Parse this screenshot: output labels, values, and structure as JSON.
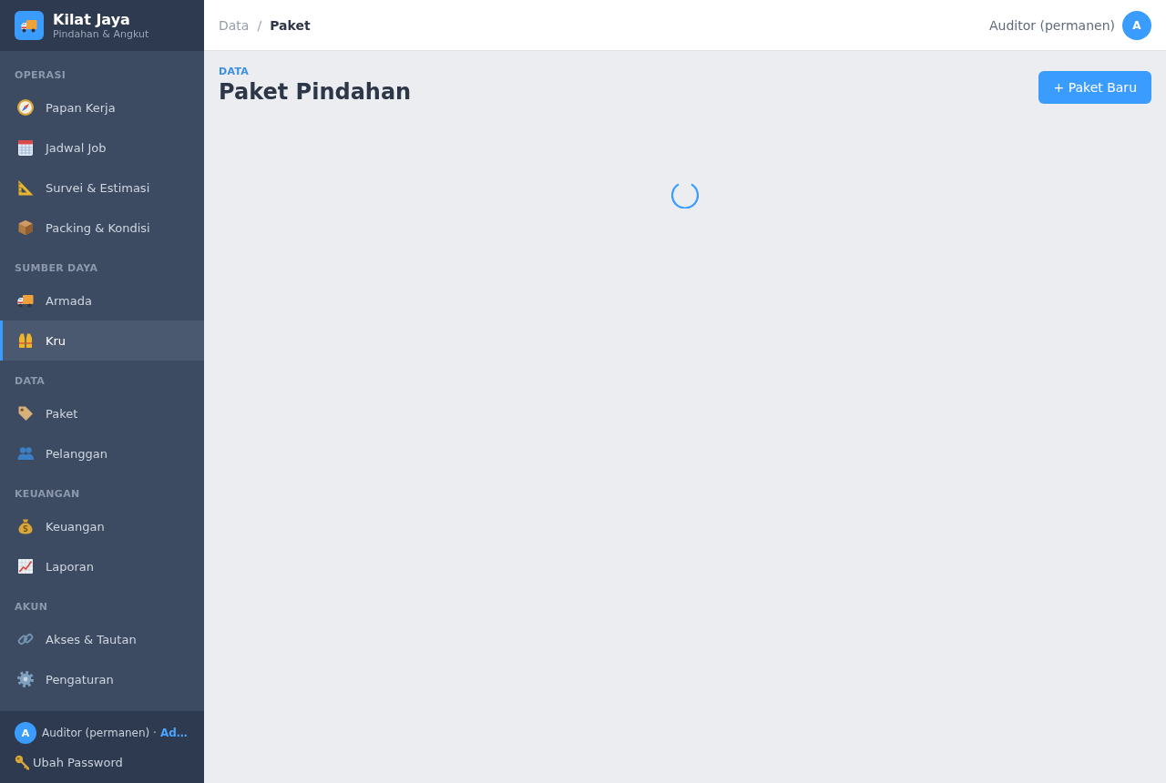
{
  "sidebar": {
    "brand": {
      "name": "Kilat Jaya",
      "tagline": "Pindahan & Angkut"
    },
    "sections": [
      {
        "title": "OPERASI",
        "items": [
          {
            "label": "Papan Kerja",
            "selected": false
          },
          {
            "label": "Jadwal Job",
            "selected": false
          },
          {
            "label": "Survei & Estimasi",
            "selected": false
          },
          {
            "label": "Packing & Kondisi",
            "selected": false
          }
        ]
      },
      {
        "title": "SUMBER DAYA",
        "items": [
          {
            "label": "Armada",
            "selected": false
          },
          {
            "label": "Kru",
            "selected": true
          }
        ]
      },
      {
        "title": "DATA",
        "items": [
          {
            "label": "Paket",
            "selected": false
          },
          {
            "label": "Pelanggan",
            "selected": false
          }
        ]
      },
      {
        "title": "KEUANGAN",
        "items": [
          {
            "label": "Keuangan",
            "selected": false
          },
          {
            "label": "Laporan",
            "selected": false
          }
        ]
      },
      {
        "title": "AKUN",
        "items": [
          {
            "label": "Akses & Tautan",
            "selected": false
          },
          {
            "label": "Pengaturan",
            "selected": false
          }
        ]
      }
    ],
    "footer": {
      "user": {
        "avatar": "A",
        "name": "Auditor (permanen) ·",
        "role": "Ad…"
      },
      "link": "Ubah Password"
    }
  },
  "topbar": {
    "breadcrumb": {
      "items": [
        "Data",
        "Paket"
      ],
      "separator": "/"
    },
    "user": {
      "name": "Auditor (permanen)",
      "avatar": "A"
    }
  },
  "page": {
    "eyebrow": "DATA",
    "title": "Paket Pindahan",
    "primary_button": "+ Paket Baru",
    "loading": true
  }
}
